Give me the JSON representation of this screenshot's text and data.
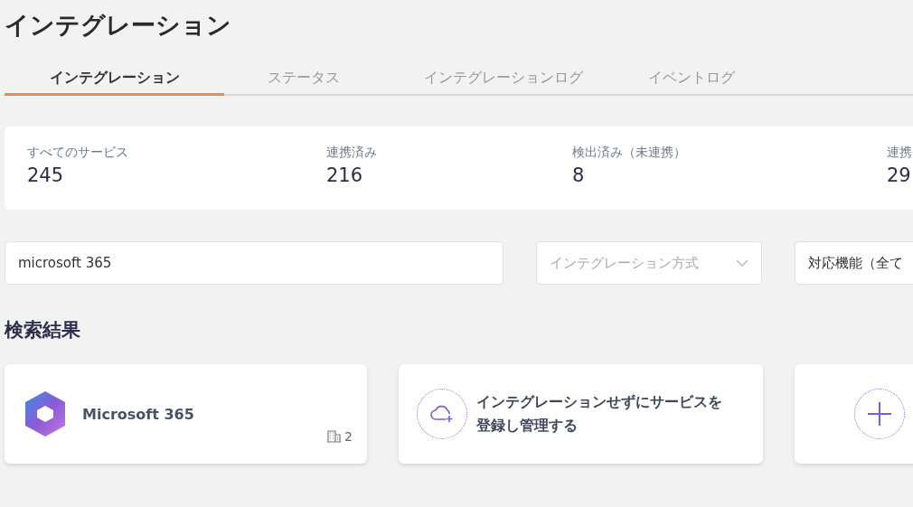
{
  "page": {
    "title": "インテグレーション"
  },
  "tabs": [
    {
      "label": "インテグレーション",
      "selected": true
    },
    {
      "label": "ステータス",
      "selected": false
    },
    {
      "label": "インテグレーションログ",
      "selected": false
    },
    {
      "label": "イベントログ",
      "selected": false
    }
  ],
  "stats": [
    {
      "label": "すべてのサービス",
      "value": "245"
    },
    {
      "label": "連携済み",
      "value": "216"
    },
    {
      "label": "検出済み（未連携）",
      "value": "8"
    },
    {
      "label": "連携",
      "value": "29"
    }
  ],
  "filters": {
    "search": {
      "value": "microsoft 365"
    },
    "method": {
      "placeholder": "インテグレーション方式"
    },
    "feature": {
      "value": "対応機能（全て"
    }
  },
  "results": {
    "heading": "検索結果",
    "cards": [
      {
        "kind": "service",
        "name": "Microsoft 365",
        "count": "2"
      },
      {
        "kind": "register",
        "text": "インテグレーションせずにサービスを登録し管理する"
      },
      {
        "kind": "add"
      }
    ]
  }
}
